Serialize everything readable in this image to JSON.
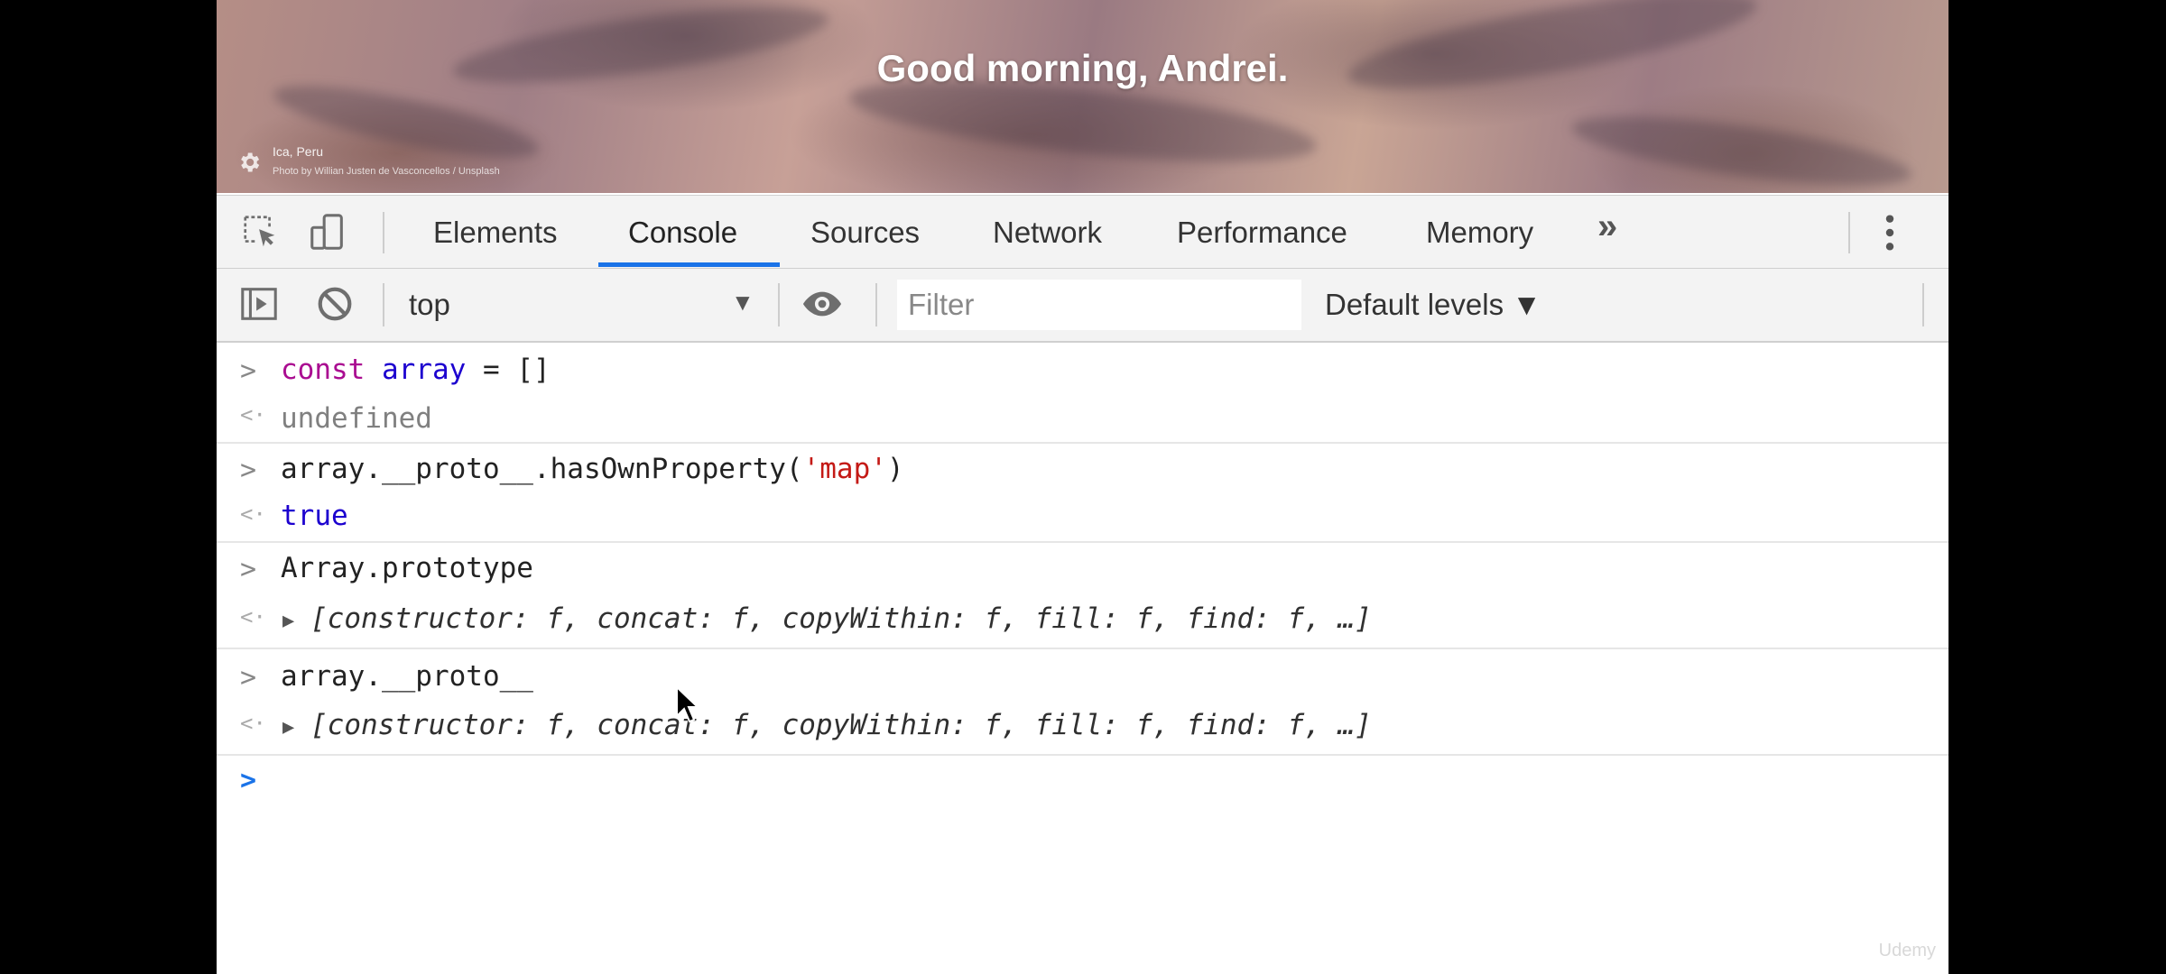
{
  "banner": {
    "greeting": "Good morning, Andrei.",
    "location": "Ica, Peru",
    "credit": "Photo by Willian Justen de Vasconcellos / Unsplash"
  },
  "devtools": {
    "tabs": [
      {
        "label": "Elements"
      },
      {
        "label": "Console",
        "active": true
      },
      {
        "label": "Sources"
      },
      {
        "label": "Network"
      },
      {
        "label": "Performance"
      },
      {
        "label": "Memory"
      }
    ],
    "more_tabs": "»",
    "menu_icon": "more-vert-icon",
    "accent_color": "#1a73e8"
  },
  "toolbar": {
    "context": "top",
    "filter_placeholder": "Filter",
    "levels": "Default levels ▼"
  },
  "console": {
    "entries": [
      {
        "input": [
          "const",
          "array",
          "=",
          "[]"
        ],
        "output": "undefined"
      },
      {
        "input": [
          "array.__proto__.hasOwnProperty(",
          "'map'",
          ")"
        ],
        "output": "true"
      },
      {
        "input": "Array.prototype",
        "output": "[constructor: f, concat: f, copyWithin: f, fill: f, find: f, …]"
      },
      {
        "input": "array.__proto__",
        "output": "[constructor: f, concat: f, copyWithin: f, fill: f, find: f, …]"
      }
    ]
  },
  "watermark": "Udemy"
}
